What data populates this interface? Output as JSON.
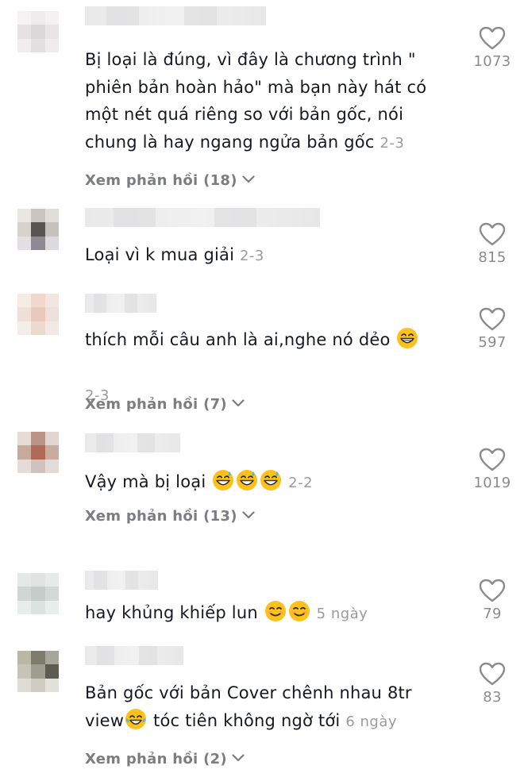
{
  "comments": [
    {
      "text": "Bị loại là đúng, vì đây là chương trình \"\nphiên bản hoàn hảo\" mà bạn này hát có\nmột nét quá riêng so với bản gốc, nói\nchung là hay ngang ngửa bản gốc ",
      "date": "2-3",
      "likes": "1073",
      "replies": "Xem phản hồi (18)",
      "emoji_after": [],
      "text_after": ""
    },
    {
      "text": "Loại vì k mua giải ",
      "date": "2-3",
      "likes": "815",
      "replies": "",
      "emoji_after": [],
      "text_after": ""
    },
    {
      "text": "thích mỗi câu anh là ai,nghe nó dẻo ",
      "date": "2-3",
      "likes": "597",
      "replies": "Xem phản hồi (7)",
      "emoji_after": [
        "grinning-face-emoji"
      ],
      "text_after": ""
    },
    {
      "text": "Vậy mà bị loại ",
      "date": "2-2",
      "likes": "1019",
      "replies": "Xem phản hồi (13)",
      "emoji_after": [
        "grinning-sweat-emoji",
        "grinning-sweat-emoji",
        "grinning-sweat-emoji"
      ],
      "text_after": ""
    },
    {
      "text": "hay khủng khiếp lun ",
      "date": "5 ngày",
      "likes": "79",
      "replies": "",
      "emoji_after": [
        "smiling-eyes-emoji",
        "smiling-eyes-emoji"
      ],
      "text_after": ""
    },
    {
      "text": "Bản gốc với bản Cover chênh nhau 8tr\nview",
      "date": "6 ngày",
      "likes": "83",
      "replies": "Xem phản hồi (2)",
      "emoji_after": [
        "tears-of-joy-emoji"
      ],
      "text_after": " tóc tiên không ngờ tới "
    }
  ],
  "colors": {
    "text": "#161823",
    "secondary": "#8a8b91",
    "date": "#9a9ba0",
    "heart_outline": "#8a8b91",
    "emoji_yellow": "#fcc21b"
  }
}
